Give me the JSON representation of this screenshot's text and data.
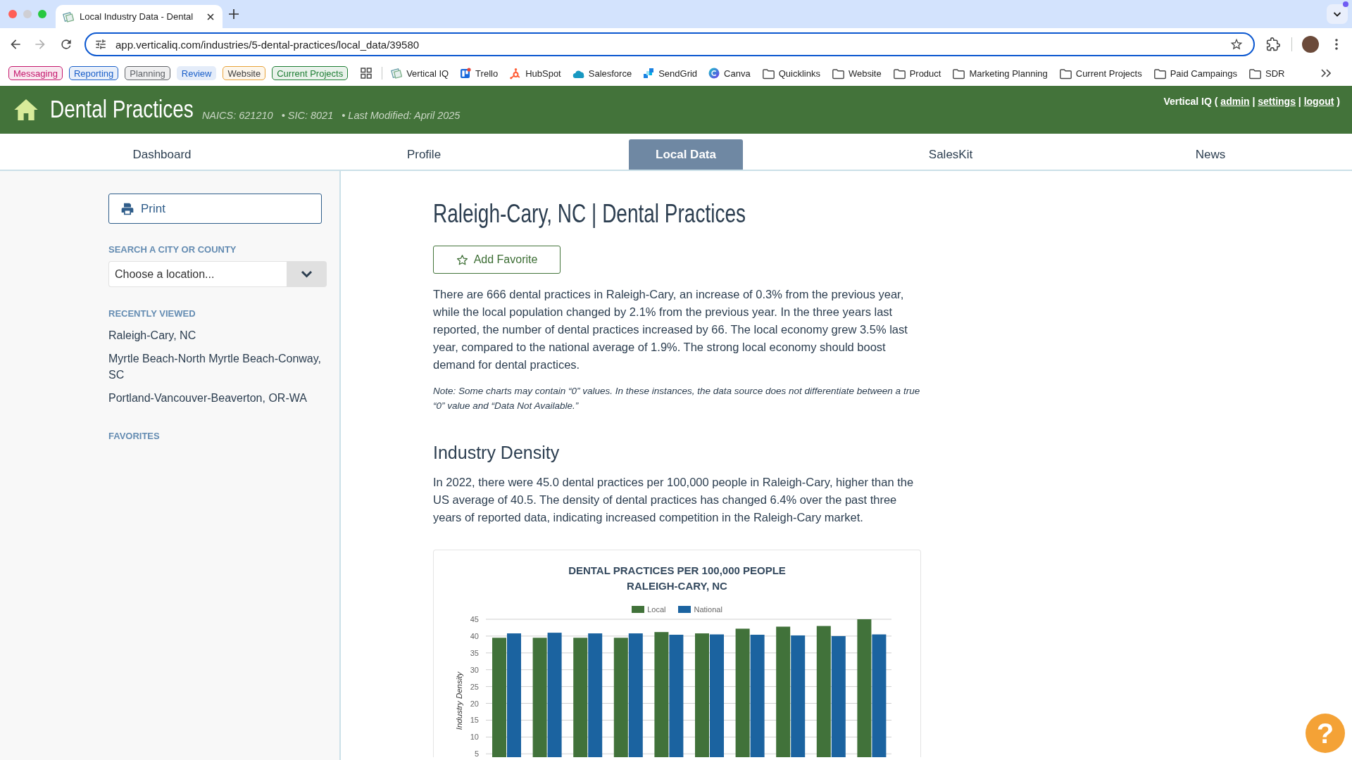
{
  "browser": {
    "tab": {
      "title": "Local Industry Data - Dental"
    },
    "address": "app.verticaliq.com/industries/5-dental-practices/local_data/39580",
    "tab_groups": [
      {
        "label": "Messaging",
        "color": "#c5186d",
        "outlined": true
      },
      {
        "label": "Reporting",
        "color": "#1a5fc9",
        "outlined": true
      },
      {
        "label": "Planning",
        "color": "#5f6368",
        "outlined": true
      },
      {
        "label": "Review",
        "color": "#1a5fc9",
        "outlined": false
      },
      {
        "label": "Website",
        "color": "#e8a33b",
        "outlined": true
      },
      {
        "label": "Current Projects",
        "color": "#1e7e34",
        "outlined": true
      }
    ],
    "bookmarks": [
      {
        "label": "Vertical IQ",
        "kind": "stacked"
      },
      {
        "label": "Trello",
        "kind": "board"
      },
      {
        "label": "HubSpot",
        "kind": "sprocket"
      },
      {
        "label": "Salesforce",
        "kind": "cloud"
      },
      {
        "label": "SendGrid",
        "kind": "blocks"
      },
      {
        "label": "Canva",
        "kind": "circle"
      },
      {
        "label": "Quicklinks",
        "kind": "folder"
      },
      {
        "label": "Website",
        "kind": "folder"
      },
      {
        "label": "Product",
        "kind": "folder"
      },
      {
        "label": "Marketing Planning",
        "kind": "folder"
      },
      {
        "label": "Current Projects",
        "kind": "folder"
      },
      {
        "label": "Paid Campaings",
        "kind": "folder"
      },
      {
        "label": "SDR",
        "kind": "folder"
      }
    ]
  },
  "header": {
    "title": "Dental Practices",
    "meta": [
      "NAICS: 621210",
      "• SIC: 8021",
      "• Last Modified: April 2025"
    ],
    "account": {
      "label": "Vertical IQ (",
      "links": [
        "admin",
        "settings",
        "logout"
      ],
      "separator": "|",
      "end": ")"
    }
  },
  "tabs": [
    {
      "label": "Dashboard",
      "selected": false
    },
    {
      "label": "Profile",
      "selected": false
    },
    {
      "label": "Local Data",
      "selected": true
    },
    {
      "label": "SalesKit",
      "selected": false
    },
    {
      "label": "News",
      "selected": false
    }
  ],
  "sidebar": {
    "print_button": {
      "label": "Print"
    },
    "search": {
      "heading": "SEARCH A CITY OR COUNTY",
      "placeholder": "Choose a location..."
    },
    "recently_viewed": {
      "heading": "RECENTLY VIEWED",
      "items": [
        "Raleigh-Cary, NC",
        "Myrtle Beach-North Myrtle Beach-Conway, SC",
        "Portland-Vancouver-Beaverton, OR-WA"
      ]
    },
    "favorites": {
      "heading": "FAVORITES"
    }
  },
  "main": {
    "title": "Raleigh-Cary, NC | Dental Practices",
    "favorite_button": {
      "label": "Add Favorite"
    },
    "summary": "There are 666 dental practices in Raleigh-Cary, an increase of 0.3% from the previous year, while the local population changed by 2.1% from the previous year. In the three years last reported, the number of dental practices increased by 66. The local economy grew 3.5% last year, compared to the national average of 1.9%. The strong local economy should boost demand for dental practices.",
    "note": "Note: Some charts may contain “0” values. In these instances, the data source does not differentiate between a true “0” value and “Data Not Available.”",
    "section": {
      "heading": "Industry Density",
      "text": "In 2022, there were 45.0 dental practices per 100,000 people in Raleigh-Cary, higher than the US average of 40.5. The density of dental practices has changed 6.4% over the past three years of reported data, indicating increased competition in the Raleigh-Cary market.",
      "chart_data": {
        "type": "bar",
        "title": "DENTAL PRACTICES PER 100,000 PEOPLE\nRALEIGH-CARY, NC",
        "ylabel": "Industry Density",
        "ylim": [
          4,
          45
        ],
        "yticks": [
          5,
          10,
          15,
          20,
          25,
          30,
          35,
          40,
          45
        ],
        "grid": true,
        "series": [
          {
            "name": "Local",
            "color": "#41723a",
            "values": [
              39.5,
              39.5,
              39.5,
              39.5,
              41.2,
              40.8,
              42.2,
              42.8,
              43.0,
              45.0
            ]
          },
          {
            "name": "National",
            "color": "#1b63a0",
            "values": [
              40.8,
              41.0,
              40.8,
              40.8,
              40.4,
              40.5,
              40.4,
              40.2,
              40.0,
              40.5
            ]
          }
        ]
      }
    }
  },
  "help_button": {
    "label": "?"
  }
}
